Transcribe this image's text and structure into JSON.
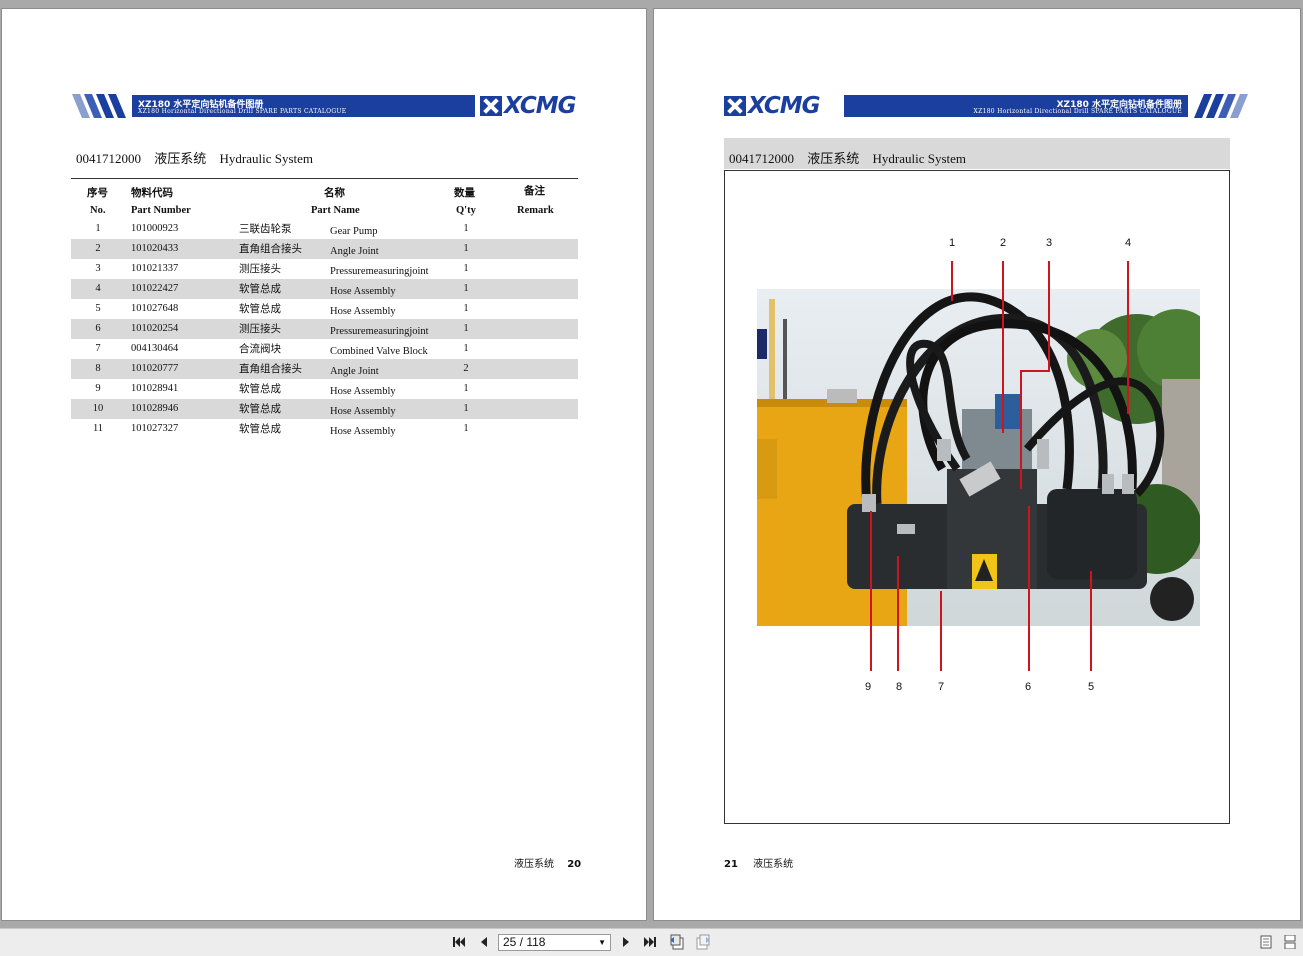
{
  "left_page": {
    "header": {
      "title_cn": "XZ180 水平定向钻机备件图册",
      "title_en": "XZ180 Horizontal Directional Drill SPARE PARTS CATALOGUE",
      "logo": "XCMG"
    },
    "section": {
      "code": "0041712000",
      "name_cn": "液压系统",
      "name_en": "Hydraulic System"
    },
    "table": {
      "headers_cn": {
        "no": "序号",
        "part_number": "物料代码",
        "part_name": "名称",
        "qty": "数量",
        "remark": "备注"
      },
      "headers_en": {
        "no": "No.",
        "part_number": "Part Number",
        "part_name": "Part Name",
        "qty": "Q'ty",
        "remark": "Remark"
      },
      "rows": [
        {
          "no": "1",
          "part_number": "101000923",
          "name_cn": "三联齿轮泵",
          "name_en": "Gear Pump",
          "qty": "1"
        },
        {
          "no": "2",
          "part_number": "101020433",
          "name_cn": "直角组合接头",
          "name_en": "Angle Joint",
          "qty": "1"
        },
        {
          "no": "3",
          "part_number": "101021337",
          "name_cn": "测压接头",
          "name_en": "Pressuremeasuringjoint",
          "qty": "1"
        },
        {
          "no": "4",
          "part_number": "101022427",
          "name_cn": "软管总成",
          "name_en": "Hose Assembly",
          "qty": "1"
        },
        {
          "no": "5",
          "part_number": "101027648",
          "name_cn": "软管总成",
          "name_en": "Hose Assembly",
          "qty": "1"
        },
        {
          "no": "6",
          "part_number": "101020254",
          "name_cn": "测压接头",
          "name_en": "Pressuremeasuringjoint",
          "qty": "1"
        },
        {
          "no": "7",
          "part_number": "004130464",
          "name_cn": "合流阀块",
          "name_en": "Combined Valve Block",
          "qty": "1"
        },
        {
          "no": "8",
          "part_number": "101020777",
          "name_cn": "直角组合接头",
          "name_en": "Angle Joint",
          "qty": "2"
        },
        {
          "no": "9",
          "part_number": "101028941",
          "name_cn": "软管总成",
          "name_en": "Hose Assembly",
          "qty": "1"
        },
        {
          "no": "10",
          "part_number": "101028946",
          "name_cn": "软管总成",
          "name_en": "Hose Assembly",
          "qty": "1"
        },
        {
          "no": "11",
          "part_number": "101027327",
          "name_cn": "软管总成",
          "name_en": "Hose Assembly",
          "qty": "1"
        }
      ]
    },
    "footer": {
      "label": "液压系统",
      "page": "20"
    }
  },
  "right_page": {
    "header": {
      "title_cn": "XZ180 水平定向钻机备件图册",
      "title_en": "XZ180 Horizontal Directional Drill SPARE PARTS CATALOGUE",
      "logo": "XCMG"
    },
    "section": {
      "code": "0041712000",
      "name_cn": "液压系统",
      "name_en": "Hydraulic System"
    },
    "callouts_top": [
      "1",
      "2",
      "3",
      "4"
    ],
    "callouts_bottom": [
      "9",
      "8",
      "7",
      "6",
      "5"
    ],
    "footer": {
      "page": "21",
      "label": "液压系统"
    }
  },
  "toolbar": {
    "page_indicator": "25 / 118",
    "buttons": [
      "first-page-icon",
      "previous-page-icon",
      "next-page-icon",
      "last-page-icon",
      "go-back-icon",
      "go-forward-icon",
      "single-page-view-icon",
      "continuous-view-icon"
    ]
  },
  "colors": {
    "brand_blue": "#1b3f9e",
    "callout_red": "#d0141e",
    "machine_yellow": "#e8a614"
  }
}
